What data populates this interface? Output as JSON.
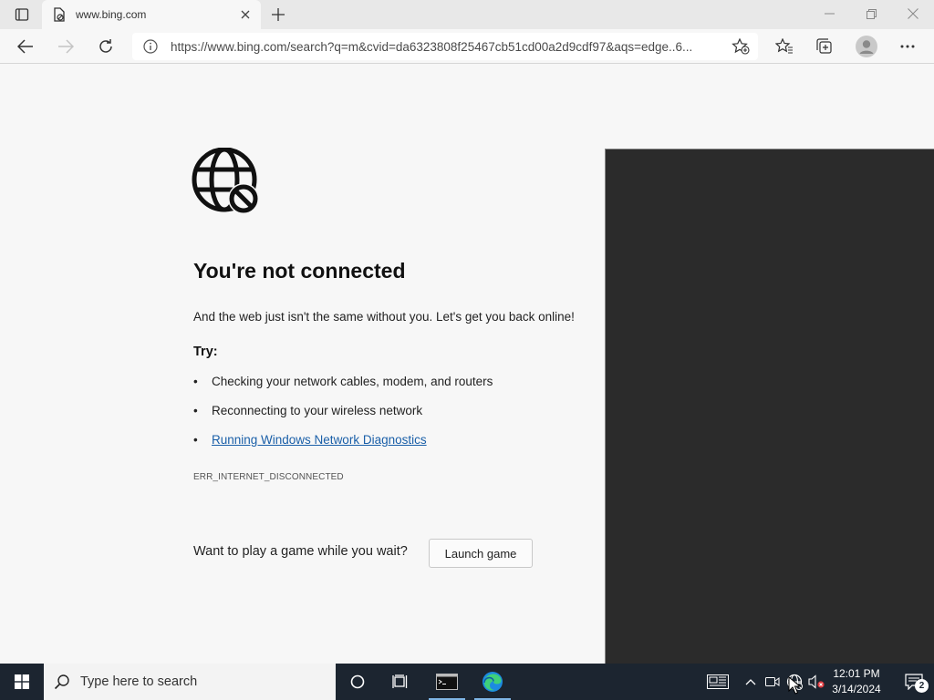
{
  "browser": {
    "tab": {
      "title": "www.bing.com"
    },
    "address": {
      "url": "https://www.bing.com/search?q=m&cvid=da6323808f25467cb51cd00a2d9cdf97&aqs=edge..6..."
    }
  },
  "page": {
    "heading": "You're not connected",
    "subtext": "And the web just isn't the same without you. Let's get you back online!",
    "try_label": "Try:",
    "suggestions": [
      "Checking your network cables, modem, and routers",
      "Reconnecting to your wireless network",
      "Running Windows Network Diagnostics"
    ],
    "error_code": "ERR_INTERNET_DISCONNECTED",
    "game_prompt": "Want to play a game while you wait?",
    "launch_button": "Launch game"
  },
  "taskbar": {
    "search_placeholder": "Type here to search",
    "time": "12:01 PM",
    "date": "3/14/2024",
    "notification_count": "2"
  },
  "colors": {
    "link": "#1a5fa8",
    "taskbar": "#1c2530",
    "dark_panel": "#2b2b2b"
  }
}
